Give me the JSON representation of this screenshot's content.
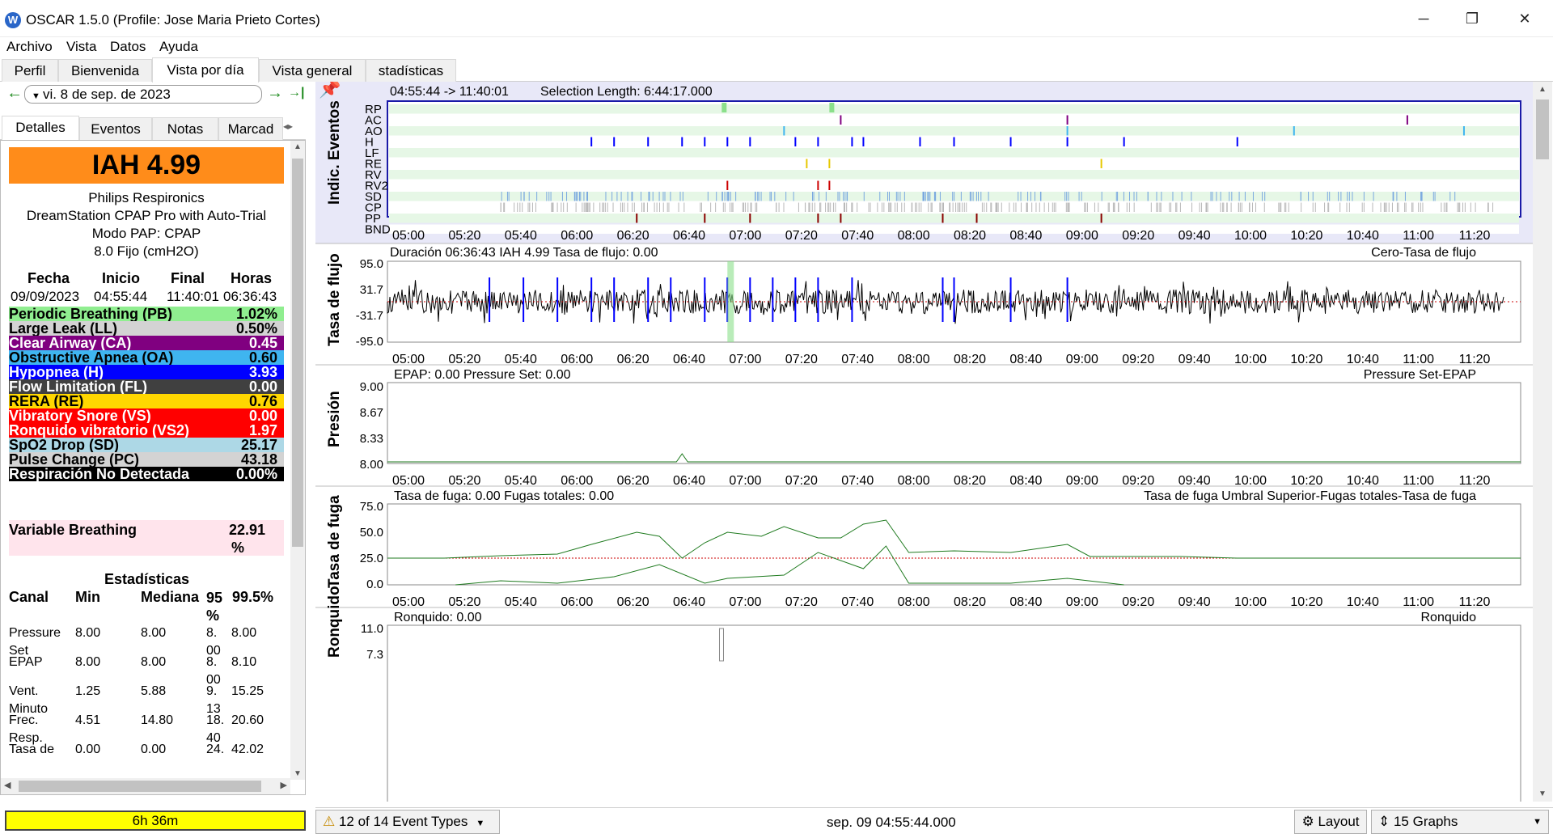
{
  "window": {
    "title": "OSCAR 1.5.0 (Profile: Jose Maria Prieto Cortes)",
    "minimize": "─",
    "maximize": "❐",
    "close": "✕"
  },
  "menu": [
    "Archivo",
    "Vista",
    "Datos",
    "Ayuda"
  ],
  "tabs": [
    "Perfil",
    "Bienvenida",
    "Vista por día",
    "Vista general",
    "stadísticas"
  ],
  "active_tab": "Vista por día",
  "date_nav": {
    "back": "←",
    "date": "vi. 8 de sep. de 2023",
    "forward": "→",
    "last": "→|"
  },
  "subtabs": [
    "Detalles",
    "Eventos",
    "Notas",
    "Marcad"
  ],
  "summary": {
    "iah": "IAH  4.99",
    "machine": [
      "Philips Respironics",
      "DreamStation CPAP Pro with Auto-Trial",
      "Modo PAP: CPAP",
      "8.0 Fijo (cmH2O)"
    ],
    "headers": {
      "fecha": "Fecha",
      "inicio": "Inicio",
      "final": "Final",
      "horas": "Horas"
    },
    "values": {
      "fecha": "09/09/2023",
      "inicio": "04:55:44",
      "final": "11:40:01",
      "horas": "06:36:43"
    }
  },
  "events": [
    {
      "label": "Periodic Breathing (PB)",
      "value": "1.02%",
      "bg": "#90ee90",
      "fg": "#000000"
    },
    {
      "label": "Large Leak (LL)",
      "value": "0.50%",
      "bg": "#d3d3d3",
      "fg": "#000000"
    },
    {
      "label": "Clear Airway (CA)",
      "value": "0.45",
      "bg": "#800080",
      "fg": "#ffffff"
    },
    {
      "label": "Obstructive Apnea (OA)",
      "value": "0.60",
      "bg": "#3fb5f0",
      "fg": "#000000"
    },
    {
      "label": "Hypopnea (H)",
      "value": "3.93",
      "bg": "#0000ff",
      "fg": "#ffffff"
    },
    {
      "label": "Flow Limitation (FL)",
      "value": "0.00",
      "bg": "#404040",
      "fg": "#ffffff"
    },
    {
      "label": "RERA (RE)",
      "value": "0.76",
      "bg": "#ffd700",
      "fg": "#000000"
    },
    {
      "label": "Vibratory Snore (VS)",
      "value": "0.00",
      "bg": "#ff0000",
      "fg": "#ffffff"
    },
    {
      "label": "Ronquido vibratorio (VS2)",
      "value": "1.97",
      "bg": "#ff0000",
      "fg": "#ffffff"
    },
    {
      "label": "SpO2 Drop (SD)",
      "value": "25.17",
      "bg": "#add8e6",
      "fg": "#000000"
    },
    {
      "label": "Pulse Change (PC)",
      "value": "43.18",
      "bg": "#d3d3d3",
      "fg": "#000000"
    },
    {
      "label": "Respiración No Detectada",
      "value": "0.00%",
      "bg": "#000000",
      "fg": "#ffffff"
    }
  ],
  "variable_breathing": {
    "label": "Variable Breathing",
    "value": "22.91",
    "unit": "%",
    "bg": "#ffe4ec"
  },
  "stats": {
    "title": "Estadísticas",
    "headers": [
      "Canal",
      "Min",
      "Mediana",
      "95 %",
      "99.5%"
    ],
    "rows": [
      {
        "canal": "Pressure Set",
        "min": "8.00",
        "med": "8.00",
        "p95": "8. 00",
        "p995": "8.00"
      },
      {
        "canal": "EPAP",
        "min": "8.00",
        "med": "8.00",
        "p95": "8. 00",
        "p995": "8.10"
      },
      {
        "canal": "Vent. Minuto",
        "min": "1.25",
        "med": "5.88",
        "p95": "9. 13",
        "p995": "15.25"
      },
      {
        "canal": "Frec. Resp.",
        "min": "4.51",
        "med": "14.80",
        "p95": "18. 40",
        "p995": "20.60"
      },
      {
        "canal": "Tasa de",
        "min": "0.00",
        "med": "0.00",
        "p95": "24.",
        "p995": "42.02"
      }
    ]
  },
  "duration": "6h 36m",
  "time_ticks": [
    "05:00",
    "05:20",
    "05:40",
    "06:00",
    "06:20",
    "06:40",
    "07:00",
    "07:20",
    "07:40",
    "08:00",
    "08:20",
    "08:40",
    "09:00",
    "09:20",
    "09:40",
    "10:00",
    "10:20",
    "10:40",
    "11:00",
    "11:20"
  ],
  "graphs": {
    "events": {
      "ylabel": "Indic. Eventos",
      "header_range": "04:55:44 -> 11:40:01",
      "header_sel": "Selection Length: 6:44:17.000",
      "rows": [
        "RP",
        "AC",
        "AO",
        "H",
        "LF",
        "RE",
        "RV",
        "RV2",
        "SD",
        "CP",
        "PP",
        "BND"
      ]
    },
    "flow": {
      "ylabel": "Tasa de flujo",
      "header": "Duración 06:36:43 IAH 4.99 Tasa de flujo: 0.00",
      "legend": "Cero-Tasa de flujo",
      "ticks": [
        "95.0",
        "31.7",
        "-31.7",
        "-95.0"
      ]
    },
    "pressure": {
      "ylabel": "Presión",
      "header": "EPAP: 0.00 Pressure Set: 0.00",
      "legend": "Pressure Set-EPAP",
      "ticks": [
        "9.00",
        "8.67",
        "8.33",
        "8.00"
      ]
    },
    "leak": {
      "ylabel": "Tasa de fuga",
      "header": "Tasa de fuga: 0.00 Fugas totales: 0.00",
      "legend": "Tasa de fuga Umbral Superior-Fugas totales-Tasa de fuga",
      "ticks": [
        "75.0",
        "50.0",
        "25.0",
        "0.0"
      ]
    },
    "snore": {
      "ylabel": "Ronquido",
      "header": "Ronquido: 0.00",
      "legend": "Ronquido",
      "ticks": [
        "11.0",
        "7.3"
      ]
    }
  },
  "status": {
    "event_types": "12 of 14 Event Types",
    "timestamp": "sep. 09 04:55:44.000",
    "layout": "Layout",
    "graphs": "15 Graphs"
  },
  "colors": {
    "accent_green": "#1d8a1d",
    "flow_trace": "#000000",
    "leak_trace": "#1e7a1e",
    "threshold": "#cc0000",
    "event_row_bg": "#e6f7e6"
  }
}
